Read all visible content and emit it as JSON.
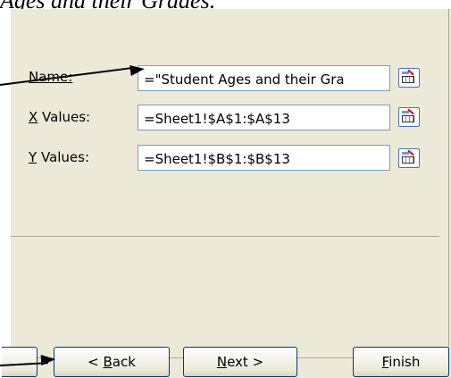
{
  "caption": "Ages and their Grades.",
  "series": {
    "name_label": "Name:",
    "name_value": "=\"Student Ages and their Gra",
    "x_label_key": "X",
    "x_label_rest": " Values:",
    "x_value": "=Sheet1!$A$1:$A$13",
    "y_label_key": "Y",
    "y_label_rest": " Values:",
    "y_value": "=Sheet1!$B$1:$B$13"
  },
  "buttons": {
    "back_pre": "< ",
    "back_key": "B",
    "back_rest": "ack",
    "next_key": "N",
    "next_rest": "ext >",
    "finish_key": "F",
    "finish_rest": "inish"
  },
  "icons": {
    "collapse": "collapse-dialog-icon",
    "arrow": "arrow-annotation"
  }
}
